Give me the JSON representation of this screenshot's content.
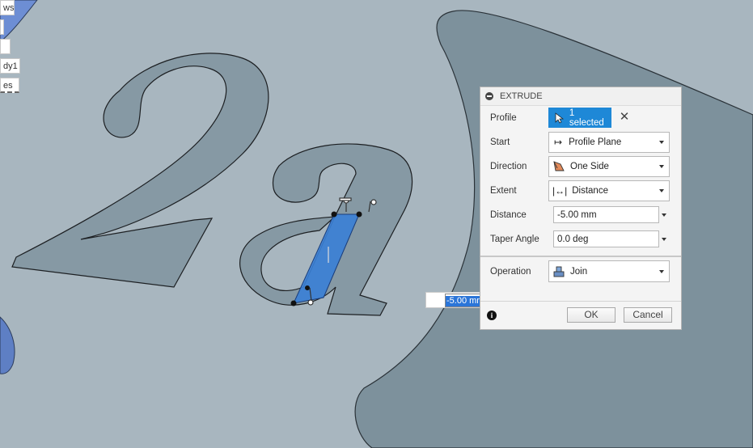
{
  "browser": {
    "items": [
      {
        "label": "ws"
      },
      {
        "label": ""
      },
      {
        "label": ""
      },
      {
        "label": "dy1"
      },
      {
        "label": "es"
      }
    ]
  },
  "extrude": {
    "title": "EXTRUDE",
    "profile": {
      "label": "Profile",
      "value": "1 selected"
    },
    "start": {
      "label": "Start",
      "value": "Profile Plane"
    },
    "direction": {
      "label": "Direction",
      "value": "One Side"
    },
    "extent": {
      "label": "Extent",
      "value": "Distance"
    },
    "distance": {
      "label": "Distance",
      "value": "-5.00 mm"
    },
    "taper": {
      "label": "Taper Angle",
      "value": "0.0 deg"
    },
    "operation": {
      "label": "Operation",
      "value": "Join"
    },
    "ok_label": "OK",
    "cancel_label": "Cancel"
  },
  "canvas": {
    "inline_distance": "-5.00 mm",
    "text_glyphs": "2a"
  },
  "colors": {
    "background": "#a9b6bf",
    "plate": "#7d919c",
    "sketch_fill": "#8699a4",
    "selection": "#3a7fd6",
    "accent_button": "#1e88d7"
  }
}
